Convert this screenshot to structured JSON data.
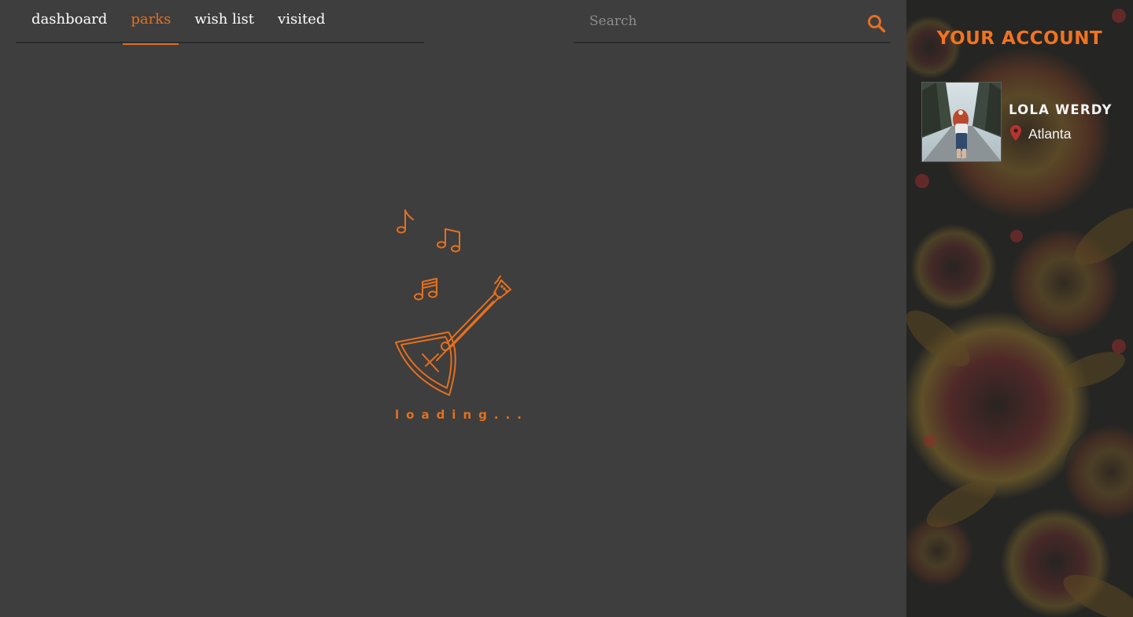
{
  "nav": {
    "tabs": [
      {
        "label": "dashboard",
        "active": false
      },
      {
        "label": "parks",
        "active": true
      },
      {
        "label": "wish list",
        "active": false
      },
      {
        "label": "visited",
        "active": false
      }
    ]
  },
  "search": {
    "placeholder": "Search",
    "value": "",
    "icon": "search-icon"
  },
  "loader": {
    "text": "loading...",
    "icon": "balalaika-icon",
    "notes_icon": "music-notes-icon"
  },
  "account": {
    "title": "YOUR ACCOUNT",
    "user_name": "LOLA WERDY",
    "location": "Atlanta",
    "location_icon": "map-pin-icon",
    "avatar": "user-avatar-photo"
  },
  "colors": {
    "background": "#3e3e3e",
    "accent": "#e4701f",
    "panel": "#252523",
    "pin": "#b8322e",
    "text": "#ffffff",
    "placeholder": "#8d8d8d"
  }
}
